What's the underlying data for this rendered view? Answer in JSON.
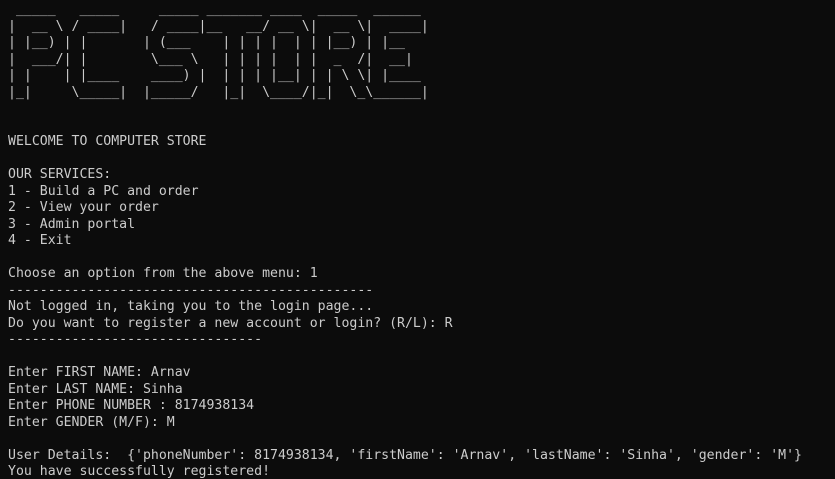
{
  "logo": {
    "lines": [
      " _____   _____     _____ _______ ____  _____  ______ ",
      "|  __ \\ / ____|   / ____|__   __/ __ \\|  __ \\|  ____|",
      "| |__) | |       | (___    | | | |  | | |__) | |__   ",
      "|  ___/| |        \\___ \\   | | | |  | |  _  /|  __|  ",
      "| |    | |____    ____) |  | | | |__| | | \\ \\| |____ ",
      "|_|     \\_____|  |_____/   |_|  \\____/|_|  \\_\\______|"
    ]
  },
  "output": [
    "",
    "",
    "WELCOME TO COMPUTER STORE",
    "",
    "OUR SERVICES:",
    "1 - Build a PC and order",
    "2 - View your order",
    "3 - Admin portal",
    "4 - Exit",
    "",
    "Choose an option from the above menu: 1",
    "----------------------------------------------",
    "Not logged in, taking you to the login page...",
    "Do you want to register a new account or login? (R/L): R",
    "--------------------------------",
    "",
    "Enter FIRST NAME: Arnav",
    "Enter LAST NAME: Sinha",
    "Enter PHONE NUMBER : 8174938134",
    "Enter GENDER (M/F): M",
    "",
    "User Details:  {'phoneNumber': 8174938134, 'firstName': 'Arnav', 'lastName': 'Sinha', 'gender': 'M'}",
    "You have successfully registered!"
  ]
}
